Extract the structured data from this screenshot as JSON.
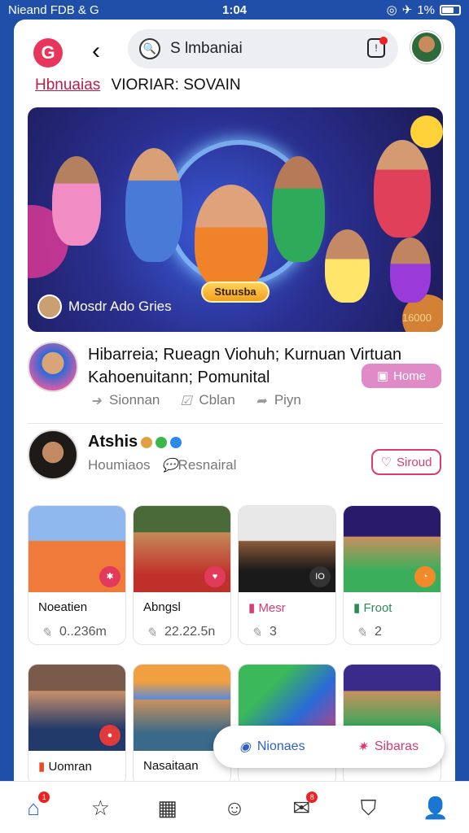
{
  "status_bar": {
    "left": "Nieand FDB & G",
    "time": "1:04",
    "right": "1%"
  },
  "header": {
    "search_query": "S lmbaniai"
  },
  "subhead": {
    "link": "Hbnuaias",
    "rest": "VIORIAR: SOVAIN"
  },
  "hero": {
    "pill": "Stuusba",
    "creator": "Mosdr Ado Gries",
    "count": "16000"
  },
  "post1": {
    "title_line1": "Hibarreia; Rueagn Viohuh; Kurnuan Virtuan",
    "title_line2": "Kahoenuitann; Pomunital",
    "tag_label": "Home",
    "actions": [
      "Sionnan",
      "Cblan",
      "Piyn"
    ]
  },
  "post2": {
    "name": "Atshis",
    "meta_1": "Houmiaos",
    "meta_2": "Resnairal",
    "follow_label": "Siroud"
  },
  "tiles": [
    {
      "label": "Noeatien",
      "count": "0..236m",
      "color": "#f1f1f1"
    },
    {
      "label": "Abngsl",
      "count": "22.22.5n",
      "color": "#f1f1f1"
    },
    {
      "label": "Mesr",
      "count": "3",
      "color": "#d83d6f"
    },
    {
      "label": "Froot",
      "count": "2",
      "color": "#2e8b57"
    },
    {
      "label": "Uomran",
      "count": "",
      "color": "#f1f1f1"
    },
    {
      "label": "Nasaitaan",
      "count": "",
      "color": "#f1f1f1"
    }
  ],
  "floatbar": {
    "left": "Nionaes",
    "right": "Sibaras"
  },
  "nav": {
    "home_badge": "1",
    "chat_badge": "8"
  }
}
